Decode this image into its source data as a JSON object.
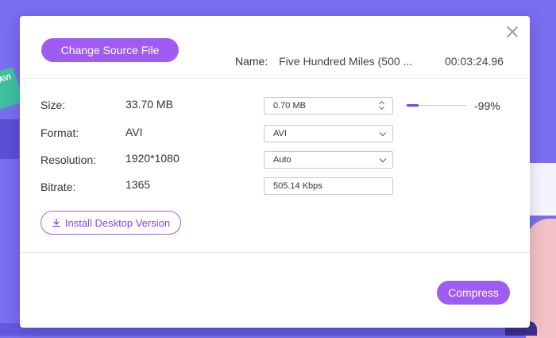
{
  "background": {
    "left_card_text": "AVI"
  },
  "dialog": {
    "change_source_label": "Change Source File",
    "name_label": "Name:",
    "name_value": "Five Hundred Miles (500 ...",
    "duration": "00:03:24.96",
    "rows": {
      "size": {
        "label": "Size:",
        "value": "33.70 MB",
        "target": "0.70  MB",
        "percent": "-99%"
      },
      "format": {
        "label": "Format:",
        "value": "AVI",
        "selected": "AVI"
      },
      "resolution": {
        "label": "Resolution:",
        "value": "1920*1080",
        "selected": "Auto"
      },
      "bitrate": {
        "label": "Bitrate:",
        "value": "1365",
        "target": "505.14 Kbps"
      }
    },
    "slider_fraction": 0.2,
    "install_label": "Install Desktop Version",
    "compress_label": "Compress"
  },
  "colors": {
    "accent": "#9f5cf0",
    "background": "#7a6df0"
  }
}
